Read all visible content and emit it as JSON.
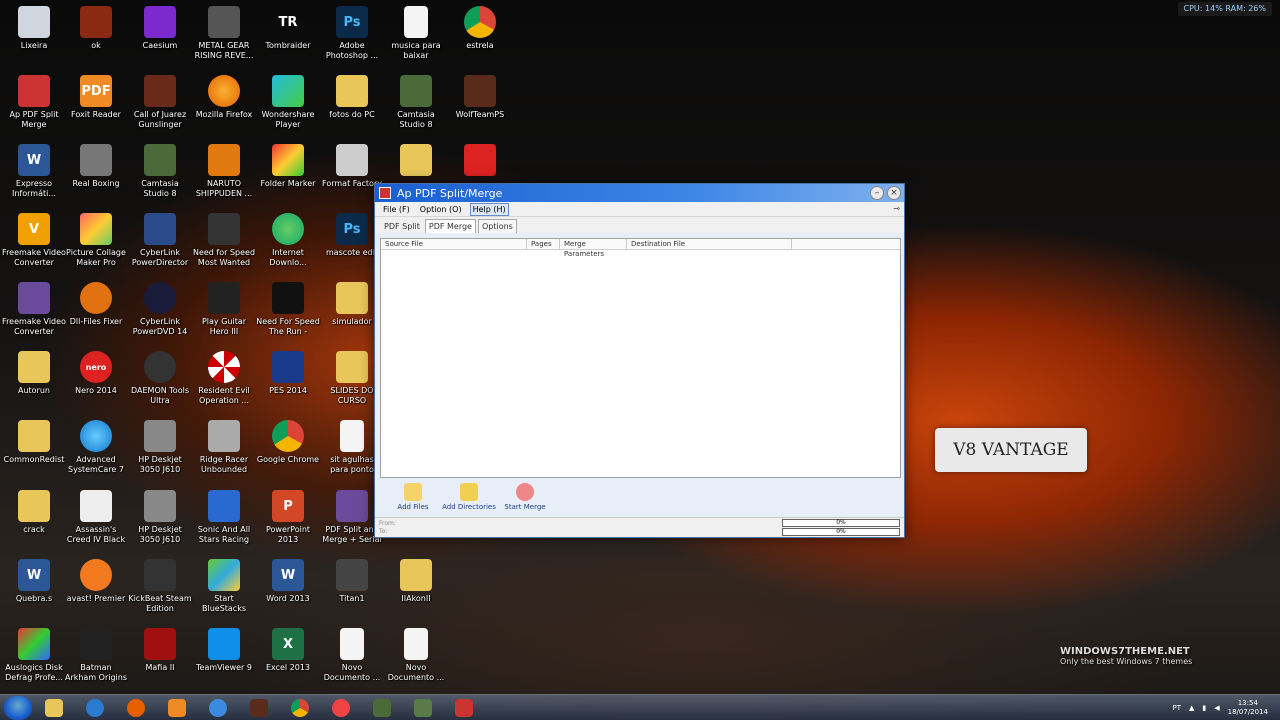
{
  "system": {
    "cpu": "CPU: 14%",
    "ram": "RAM: 26%"
  },
  "desktop_icons": [
    {
      "label": "Lixeira"
    },
    {
      "label": "ok"
    },
    {
      "label": "Caesium"
    },
    {
      "label": "METAL GEAR RISING REVE..."
    },
    {
      "label": "Tombraider"
    },
    {
      "label": "Adobe Photoshop ..."
    },
    {
      "label": "musica para baixar"
    },
    {
      "label": "estrela"
    },
    {
      "label": "Ap PDF Split Merge"
    },
    {
      "label": "Foxit Reader"
    },
    {
      "label": "Call of Juarez Gunslinger"
    },
    {
      "label": "Mozilla Firefox"
    },
    {
      "label": "Wondershare Player"
    },
    {
      "label": "fotos do PC"
    },
    {
      "label": "Camtasia Studio 8"
    },
    {
      "label": "WolfTeamPS"
    },
    {
      "label": "Expresso Informáti..."
    },
    {
      "label": "Real Boxing"
    },
    {
      "label": "Camtasia Studio 8"
    },
    {
      "label": "NARUTO SHIPPUDEN ..."
    },
    {
      "label": "Folder Marker"
    },
    {
      "label": "Format Factory"
    },
    {
      "label": ""
    },
    {
      "label": ""
    },
    {
      "label": "Freemake Video Converter"
    },
    {
      "label": "Picture Collage Maker Pro"
    },
    {
      "label": "CyberLink PowerDirector 11"
    },
    {
      "label": "Need for Speed Most Wanted"
    },
    {
      "label": "Internet Downlo..."
    },
    {
      "label": "mascote edit"
    },
    {
      "label": "Freemake Video Converter Gold..."
    },
    {
      "label": "Dll-Files Fixer"
    },
    {
      "label": "CyberLink PowerDVD 14"
    },
    {
      "label": "Play Guitar Hero III"
    },
    {
      "label": "Need For Speed The Run - Atalho"
    },
    {
      "label": "simulador"
    },
    {
      "label": "Autorun"
    },
    {
      "label": "Nero 2014"
    },
    {
      "label": "DAEMON Tools Ultra"
    },
    {
      "label": "Resident Evil Operation ..."
    },
    {
      "label": "PES 2014"
    },
    {
      "label": "SLIDES DO CURSO"
    },
    {
      "label": "CommonRedist"
    },
    {
      "label": "Advanced SystemCare 7"
    },
    {
      "label": "HP Deskjet 3050 J610 series Scan"
    },
    {
      "label": "Ridge Racer Unbounded"
    },
    {
      "label": "Google Chrome"
    },
    {
      "label": "sit agulhas para ponto russo"
    },
    {
      "label": "crack"
    },
    {
      "label": "Assassin's Creed IV Black Flag"
    },
    {
      "label": "HP Deskjet 3050 J610 series"
    },
    {
      "label": "Sonic And All Stars Racing"
    },
    {
      "label": "PowerPoint 2013"
    },
    {
      "label": "PDF Split and Merge + Serial"
    },
    {
      "label": "Quebra.s"
    },
    {
      "label": "avast! Premier"
    },
    {
      "label": "KickBeat Steam Edition"
    },
    {
      "label": "Start BlueStacks"
    },
    {
      "label": "Word 2013"
    },
    {
      "label": "Titan1"
    },
    {
      "label": "IIAkonII"
    },
    {
      "label": "Auslogics Disk Defrag Profe..."
    },
    {
      "label": "Batman Arkham Origins"
    },
    {
      "label": "Mafia II"
    },
    {
      "label": "TeamViewer 9"
    },
    {
      "label": "Excel 2013"
    },
    {
      "label": "Novo Documento ..."
    },
    {
      "label": "Novo Documento ..."
    }
  ],
  "window": {
    "title": "Ap PDF Split/Merge",
    "menu": [
      "File (F)",
      "Option (O)",
      "Help (H)"
    ],
    "tabs": [
      "PDF Split",
      "PDF Merge",
      "Options"
    ],
    "columns": [
      "Source File",
      "Pages",
      "Merge Parameters",
      "Destination File"
    ],
    "buttons": [
      "Add Files",
      "Add Directories",
      "Start Merge"
    ],
    "status": {
      "from_label": "From:",
      "to_label": "To:",
      "progress1": "0%",
      "progress2": "0%"
    }
  },
  "wallpaper": {
    "plate_text": "V8 VANTAGE",
    "brand": "WINDOWS7THEME.NET",
    "brand_sub": "Only the best Windows 7 themes"
  },
  "taskbar": {
    "lang": "PT",
    "time": "13:54",
    "date": "18/07/2014"
  }
}
